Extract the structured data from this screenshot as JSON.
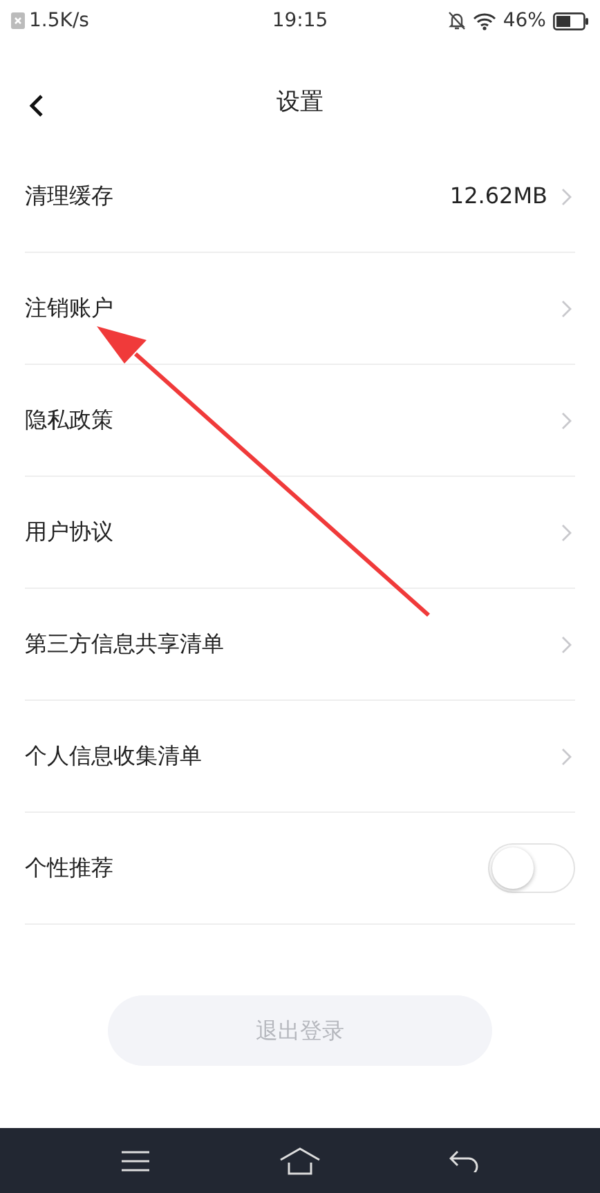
{
  "status_bar": {
    "speed": "1.5K/s",
    "time": "19:15",
    "battery": "46%"
  },
  "header": {
    "title": "设置"
  },
  "rows": [
    {
      "kind": "link",
      "label": "清理缓存",
      "value": "12.62MB"
    },
    {
      "kind": "link",
      "label": "注销账户"
    },
    {
      "kind": "link",
      "label": "隐私政策"
    },
    {
      "kind": "link",
      "label": "用户协议"
    },
    {
      "kind": "link",
      "label": "第三方信息共享清单"
    },
    {
      "kind": "link",
      "label": "个人信息收集清单"
    },
    {
      "kind": "toggle",
      "label": "个性推荐",
      "on": false
    }
  ],
  "logout_button": {
    "label": "退出登录",
    "disabled": true
  }
}
